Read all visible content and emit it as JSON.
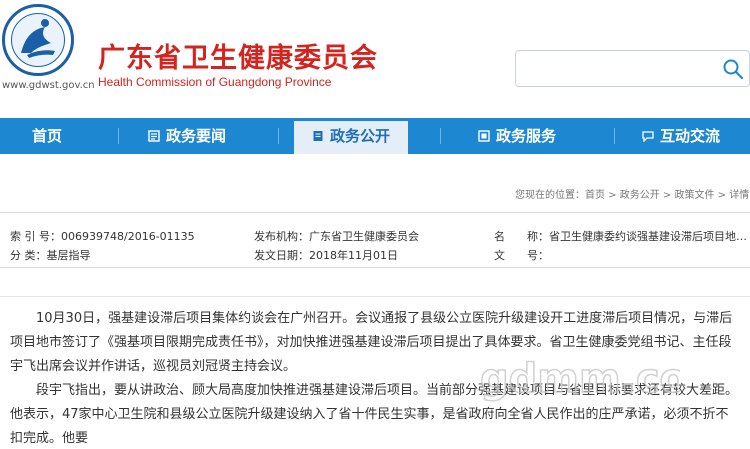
{
  "header": {
    "emblem_text": "广东省卫生健康委员会",
    "site_url": "www.gdwst.gov.cn",
    "title_cn": "广东省卫生健康委员会",
    "title_en": "Health Commission of Guangdong Province",
    "search_placeholder": "",
    "brand_color": "#d4241f"
  },
  "nav": {
    "color": "#1d87d1",
    "items": [
      {
        "label": "首页",
        "icon": ""
      },
      {
        "label": "政务要闻",
        "icon": "news-icon"
      },
      {
        "label": "政务公开",
        "icon": "document-icon",
        "active": true
      },
      {
        "label": "政务服务",
        "icon": "service-icon"
      },
      {
        "label": "互动交流",
        "icon": "chat-icon"
      }
    ]
  },
  "breadcrumb": {
    "prefix": "您现在的位置：",
    "items": [
      "首页",
      "政务公开",
      "政策文件",
      "详情"
    ],
    "separator": " > "
  },
  "meta": {
    "index_label": "索 引 号：",
    "index_value": "006939748/2016-01135",
    "category_label": "分 类：",
    "category_value": "基层指导",
    "publisher_label": "发布机构：",
    "publisher_value": "广东省卫生健康委员会",
    "date_label": "发文日期：",
    "date_value": "2018年11月01日",
    "name_label": "名　　称：",
    "name_value": "省卫生健康委约谈强基建设滞后项目地…",
    "docno_label": "文　　号：",
    "docno_value": ""
  },
  "article": {
    "paragraphs": [
      "10月30日，强基建设滞后项目集体约谈会在广州召开。会议通报了县级公立医院升级建设开工进度滞后项目情况，与滞后项目地市签订了《强基项目限期完成责任书》，对加快推进强基建设滞后项目提出了具体要求。省卫生健康委党组书记、主任段宇飞出席会议并作讲话，巡视员刘冠贤主持会议。",
      "段宇飞指出，要从讲政治、顾大局高度加快推进强基建设滞后项目。当前部分强基建设项目与省里目标要求还有较大差距。他表示，47家中心卫生院和县级公立医院升级建设纳入了省十件民生实事，是省政府向全省人民作出的庄严承诺，必须不折不扣完成。他要"
    ]
  },
  "watermark": {
    "text": "gdmm.com"
  }
}
